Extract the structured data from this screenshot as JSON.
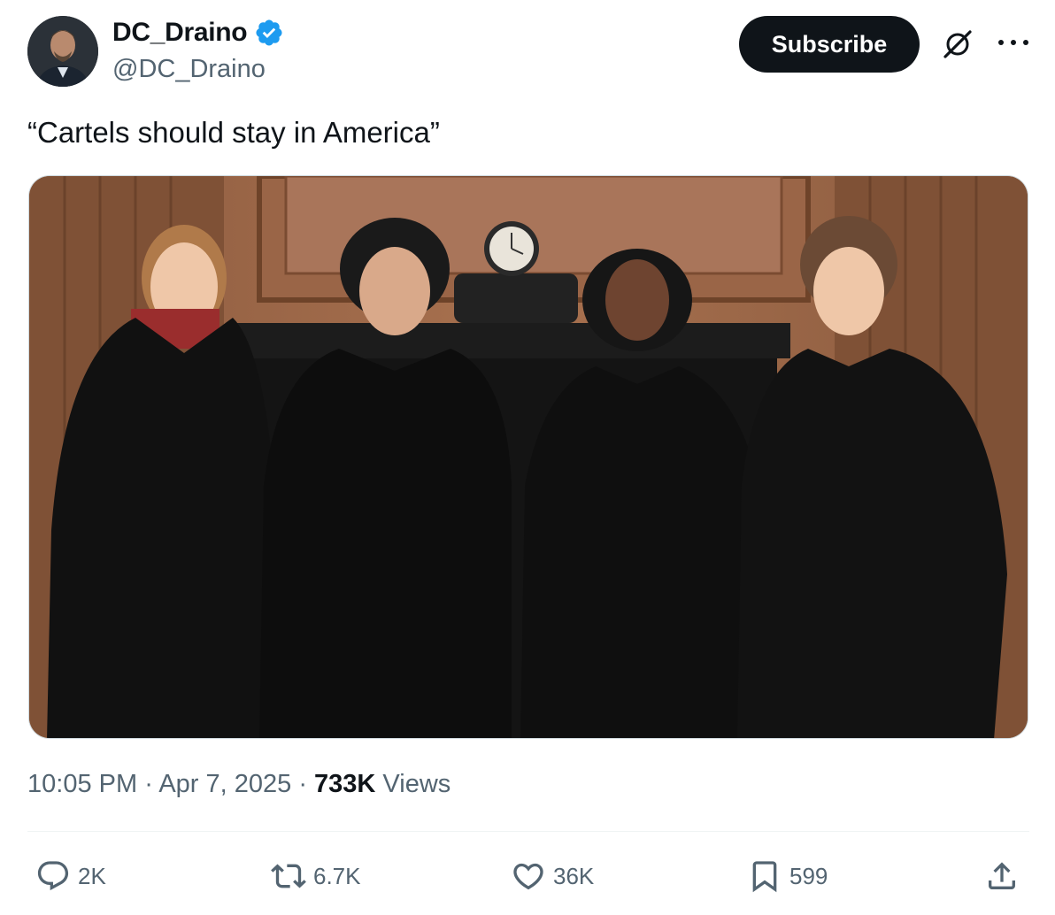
{
  "author": {
    "name": "DC_Draino",
    "handle": "@DC_Draino",
    "verified": true,
    "avatar_icon": "avatar-photo"
  },
  "header": {
    "subscribe_label": "Subscribe",
    "grok_icon": "grok-icon",
    "more_icon": "more-icon"
  },
  "tweet": {
    "text": "“Cartels should stay in America”"
  },
  "meta": {
    "time": "10:05 PM",
    "sep1": " · ",
    "date": "Apr 7, 2025",
    "sep2": " · ",
    "views_count": "733K",
    "views_label": " Views"
  },
  "actions": {
    "replies": "2K",
    "reposts": "6.7K",
    "likes": "36K",
    "bookmarks": "599"
  },
  "colors": {
    "brand_black": "#0f1419",
    "secondary_text": "#536471",
    "verified_blue": "#1d9bf0",
    "divider": "#eff3f4"
  }
}
